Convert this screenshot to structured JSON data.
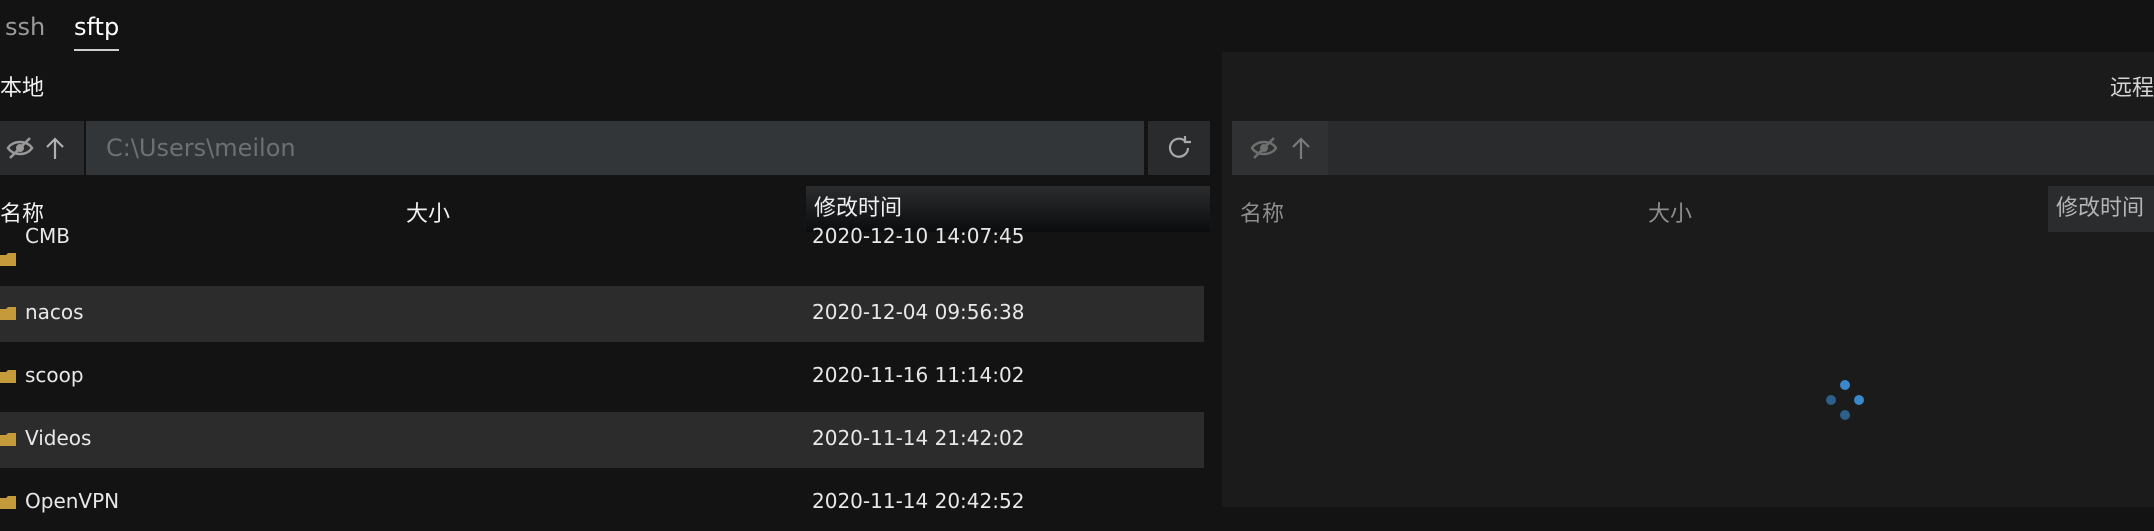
{
  "tabs": [
    {
      "label": "ssh",
      "active": false
    },
    {
      "label": "sftp",
      "active": true
    }
  ],
  "local": {
    "title": "本地",
    "path_value": "C:\\Users\\meilon",
    "columns": [
      "名称",
      "大小",
      "修改时间"
    ],
    "rows": [
      {
        "name": "CMB",
        "size": "",
        "modified": "2020-12-10 14:07:45"
      },
      {
        "name": "nacos",
        "size": "",
        "modified": "2020-12-04 09:56:38"
      },
      {
        "name": "scoop",
        "size": "",
        "modified": "2020-11-16 11:14:02"
      },
      {
        "name": "Videos",
        "size": "",
        "modified": "2020-11-14 21:42:02"
      },
      {
        "name": "OpenVPN",
        "size": "",
        "modified": "2020-11-14 20:42:52"
      }
    ]
  },
  "remote": {
    "title": "远程",
    "path_value": "",
    "columns": [
      "名称",
      "大小",
      "修改时间"
    ]
  },
  "icons": {
    "hide": "eye-off-icon",
    "up": "arrow-up-icon",
    "refresh": "refresh-icon",
    "folder": "folder-icon",
    "loading": "loading-spinner-icon"
  },
  "colors": {
    "folder": "#c59a3a",
    "spinner": "#3a87c9"
  }
}
